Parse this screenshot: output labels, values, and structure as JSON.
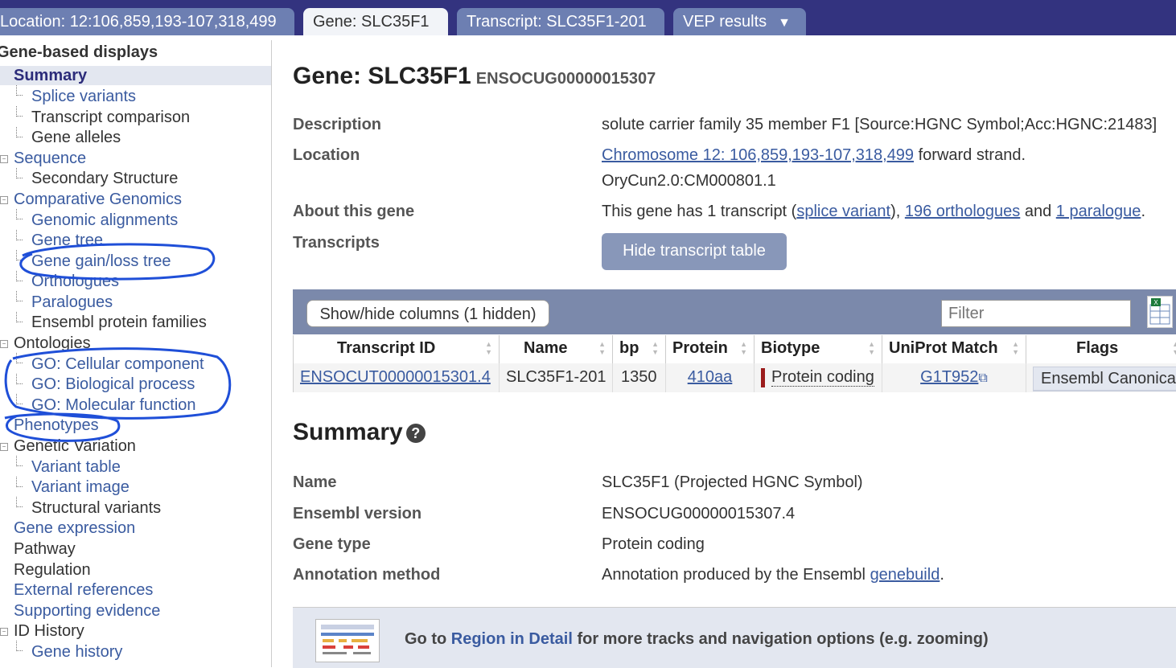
{
  "tabs": [
    {
      "label": "Location: 12:106,859,193-107,318,499"
    },
    {
      "label": "Gene: SLC35F1"
    },
    {
      "label": "Transcript: SLC35F1-201"
    },
    {
      "label": "VEP results",
      "arrow": "▼"
    }
  ],
  "sidebar": {
    "header": "Gene-based displays",
    "items": [
      {
        "label": "Summary"
      },
      {
        "label": "Splice variants"
      },
      {
        "label": "Transcript comparison"
      },
      {
        "label": "Gene alleles"
      },
      {
        "label": "Sequence"
      },
      {
        "label": "Secondary Structure"
      },
      {
        "label": "Comparative Genomics"
      },
      {
        "label": "Genomic alignments"
      },
      {
        "label": "Gene tree"
      },
      {
        "label": "Gene gain/loss tree"
      },
      {
        "label": "Orthologues"
      },
      {
        "label": "Paralogues"
      },
      {
        "label": "Ensembl protein families"
      },
      {
        "label": "Ontologies"
      },
      {
        "label": "GO: Cellular component"
      },
      {
        "label": "GO: Biological process"
      },
      {
        "label": "GO: Molecular function"
      },
      {
        "label": "Phenotypes"
      },
      {
        "label": "Genetic Variation"
      },
      {
        "label": "Variant table"
      },
      {
        "label": "Variant image"
      },
      {
        "label": "Structural variants"
      },
      {
        "label": "Gene expression"
      },
      {
        "label": "Pathway"
      },
      {
        "label": "Regulation"
      },
      {
        "label": "External references"
      },
      {
        "label": "Supporting evidence"
      },
      {
        "label": "ID History"
      },
      {
        "label": "Gene history"
      }
    ]
  },
  "gene": {
    "title": "Gene: SLC35F1",
    "stable_id": "ENSOCUG00000015307",
    "description_label": "Description",
    "description": "solute carrier family 35 member F1 [Source:HGNC Symbol;Acc:HGNC:21483]",
    "location_label": "Location",
    "location_link": "Chromosome 12: 106,859,193-107,318,499",
    "location_strand": " forward strand.",
    "assembly": "OryCun2.0:CM000801.1",
    "about_label": "About this gene",
    "about_prefix": "This gene has 1 transcript (",
    "about_splice": "splice variant",
    "about_mid1": "), ",
    "about_orthologues": "196 orthologues",
    "about_mid2": " and ",
    "about_paralogue": "1 paralogue",
    "about_end": ".",
    "transcripts_label": "Transcripts",
    "hide_button": "Hide transcript table"
  },
  "transcript_table": {
    "show_hide": "Show/hide columns (1 hidden)",
    "filter_placeholder": "Filter",
    "headers": [
      "Transcript ID",
      "Name",
      "bp",
      "Protein",
      "Biotype",
      "UniProt Match",
      "Flags"
    ],
    "row": {
      "transcript_id": "ENSOCUT00000015301.4",
      "name": "SLC35F1-201",
      "bp": "1350",
      "protein": "410aa",
      "biotype": "Protein coding",
      "uniprot": "G1T952",
      "flags": "Ensembl Canonical"
    },
    "biotype_color": "#9b1c1c"
  },
  "summary": {
    "title": "Summary",
    "help_icon": "?",
    "name_label": "Name",
    "name": "SLC35F1 (Projected HGNC Symbol)",
    "version_label": "Ensembl version",
    "version": "ENSOCUG00000015307.4",
    "type_label": "Gene type",
    "type": "Protein coding",
    "method_label": "Annotation method",
    "method_prefix": "Annotation produced by the Ensembl ",
    "method_link": "genebuild",
    "method_end": "."
  },
  "goto": {
    "prefix": "Go to ",
    "link": "Region in Detail",
    "suffix": " for more tracks and navigation options (e.g. zooming)"
  },
  "colors": {
    "topbar": "#33337f",
    "tab": "#6d7fb2",
    "link": "#3a5ba0",
    "annotation": "#1f4fd8"
  }
}
